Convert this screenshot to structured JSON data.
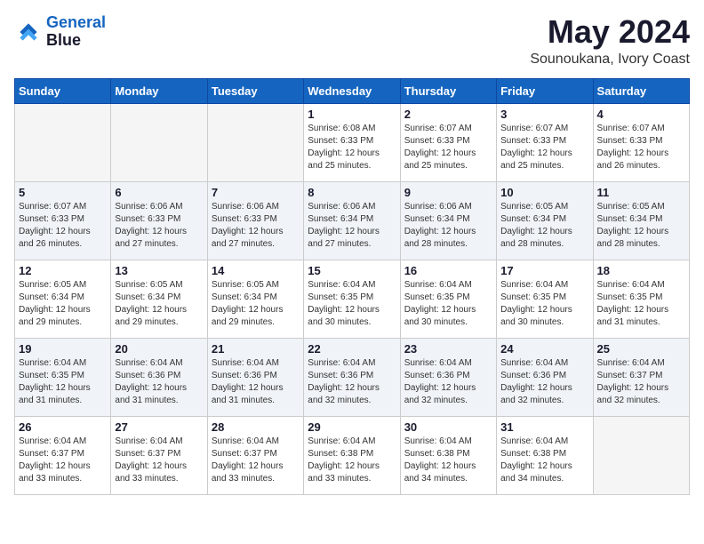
{
  "header": {
    "logo_line1": "General",
    "logo_line2": "Blue",
    "month_year": "May 2024",
    "location": "Sounoukana, Ivory Coast"
  },
  "weekdays": [
    "Sunday",
    "Monday",
    "Tuesday",
    "Wednesday",
    "Thursday",
    "Friday",
    "Saturday"
  ],
  "weeks": [
    [
      {
        "day": "",
        "info": ""
      },
      {
        "day": "",
        "info": ""
      },
      {
        "day": "",
        "info": ""
      },
      {
        "day": "1",
        "info": "Sunrise: 6:08 AM\nSunset: 6:33 PM\nDaylight: 12 hours\nand 25 minutes."
      },
      {
        "day": "2",
        "info": "Sunrise: 6:07 AM\nSunset: 6:33 PM\nDaylight: 12 hours\nand 25 minutes."
      },
      {
        "day": "3",
        "info": "Sunrise: 6:07 AM\nSunset: 6:33 PM\nDaylight: 12 hours\nand 25 minutes."
      },
      {
        "day": "4",
        "info": "Sunrise: 6:07 AM\nSunset: 6:33 PM\nDaylight: 12 hours\nand 26 minutes."
      }
    ],
    [
      {
        "day": "5",
        "info": "Sunrise: 6:07 AM\nSunset: 6:33 PM\nDaylight: 12 hours\nand 26 minutes."
      },
      {
        "day": "6",
        "info": "Sunrise: 6:06 AM\nSunset: 6:33 PM\nDaylight: 12 hours\nand 27 minutes."
      },
      {
        "day": "7",
        "info": "Sunrise: 6:06 AM\nSunset: 6:33 PM\nDaylight: 12 hours\nand 27 minutes."
      },
      {
        "day": "8",
        "info": "Sunrise: 6:06 AM\nSunset: 6:34 PM\nDaylight: 12 hours\nand 27 minutes."
      },
      {
        "day": "9",
        "info": "Sunrise: 6:06 AM\nSunset: 6:34 PM\nDaylight: 12 hours\nand 28 minutes."
      },
      {
        "day": "10",
        "info": "Sunrise: 6:05 AM\nSunset: 6:34 PM\nDaylight: 12 hours\nand 28 minutes."
      },
      {
        "day": "11",
        "info": "Sunrise: 6:05 AM\nSunset: 6:34 PM\nDaylight: 12 hours\nand 28 minutes."
      }
    ],
    [
      {
        "day": "12",
        "info": "Sunrise: 6:05 AM\nSunset: 6:34 PM\nDaylight: 12 hours\nand 29 minutes."
      },
      {
        "day": "13",
        "info": "Sunrise: 6:05 AM\nSunset: 6:34 PM\nDaylight: 12 hours\nand 29 minutes."
      },
      {
        "day": "14",
        "info": "Sunrise: 6:05 AM\nSunset: 6:34 PM\nDaylight: 12 hours\nand 29 minutes."
      },
      {
        "day": "15",
        "info": "Sunrise: 6:04 AM\nSunset: 6:35 PM\nDaylight: 12 hours\nand 30 minutes."
      },
      {
        "day": "16",
        "info": "Sunrise: 6:04 AM\nSunset: 6:35 PM\nDaylight: 12 hours\nand 30 minutes."
      },
      {
        "day": "17",
        "info": "Sunrise: 6:04 AM\nSunset: 6:35 PM\nDaylight: 12 hours\nand 30 minutes."
      },
      {
        "day": "18",
        "info": "Sunrise: 6:04 AM\nSunset: 6:35 PM\nDaylight: 12 hours\nand 31 minutes."
      }
    ],
    [
      {
        "day": "19",
        "info": "Sunrise: 6:04 AM\nSunset: 6:35 PM\nDaylight: 12 hours\nand 31 minutes."
      },
      {
        "day": "20",
        "info": "Sunrise: 6:04 AM\nSunset: 6:36 PM\nDaylight: 12 hours\nand 31 minutes."
      },
      {
        "day": "21",
        "info": "Sunrise: 6:04 AM\nSunset: 6:36 PM\nDaylight: 12 hours\nand 31 minutes."
      },
      {
        "day": "22",
        "info": "Sunrise: 6:04 AM\nSunset: 6:36 PM\nDaylight: 12 hours\nand 32 minutes."
      },
      {
        "day": "23",
        "info": "Sunrise: 6:04 AM\nSunset: 6:36 PM\nDaylight: 12 hours\nand 32 minutes."
      },
      {
        "day": "24",
        "info": "Sunrise: 6:04 AM\nSunset: 6:36 PM\nDaylight: 12 hours\nand 32 minutes."
      },
      {
        "day": "25",
        "info": "Sunrise: 6:04 AM\nSunset: 6:37 PM\nDaylight: 12 hours\nand 32 minutes."
      }
    ],
    [
      {
        "day": "26",
        "info": "Sunrise: 6:04 AM\nSunset: 6:37 PM\nDaylight: 12 hours\nand 33 minutes."
      },
      {
        "day": "27",
        "info": "Sunrise: 6:04 AM\nSunset: 6:37 PM\nDaylight: 12 hours\nand 33 minutes."
      },
      {
        "day": "28",
        "info": "Sunrise: 6:04 AM\nSunset: 6:37 PM\nDaylight: 12 hours\nand 33 minutes."
      },
      {
        "day": "29",
        "info": "Sunrise: 6:04 AM\nSunset: 6:38 PM\nDaylight: 12 hours\nand 33 minutes."
      },
      {
        "day": "30",
        "info": "Sunrise: 6:04 AM\nSunset: 6:38 PM\nDaylight: 12 hours\nand 34 minutes."
      },
      {
        "day": "31",
        "info": "Sunrise: 6:04 AM\nSunset: 6:38 PM\nDaylight: 12 hours\nand 34 minutes."
      },
      {
        "day": "",
        "info": ""
      }
    ]
  ]
}
